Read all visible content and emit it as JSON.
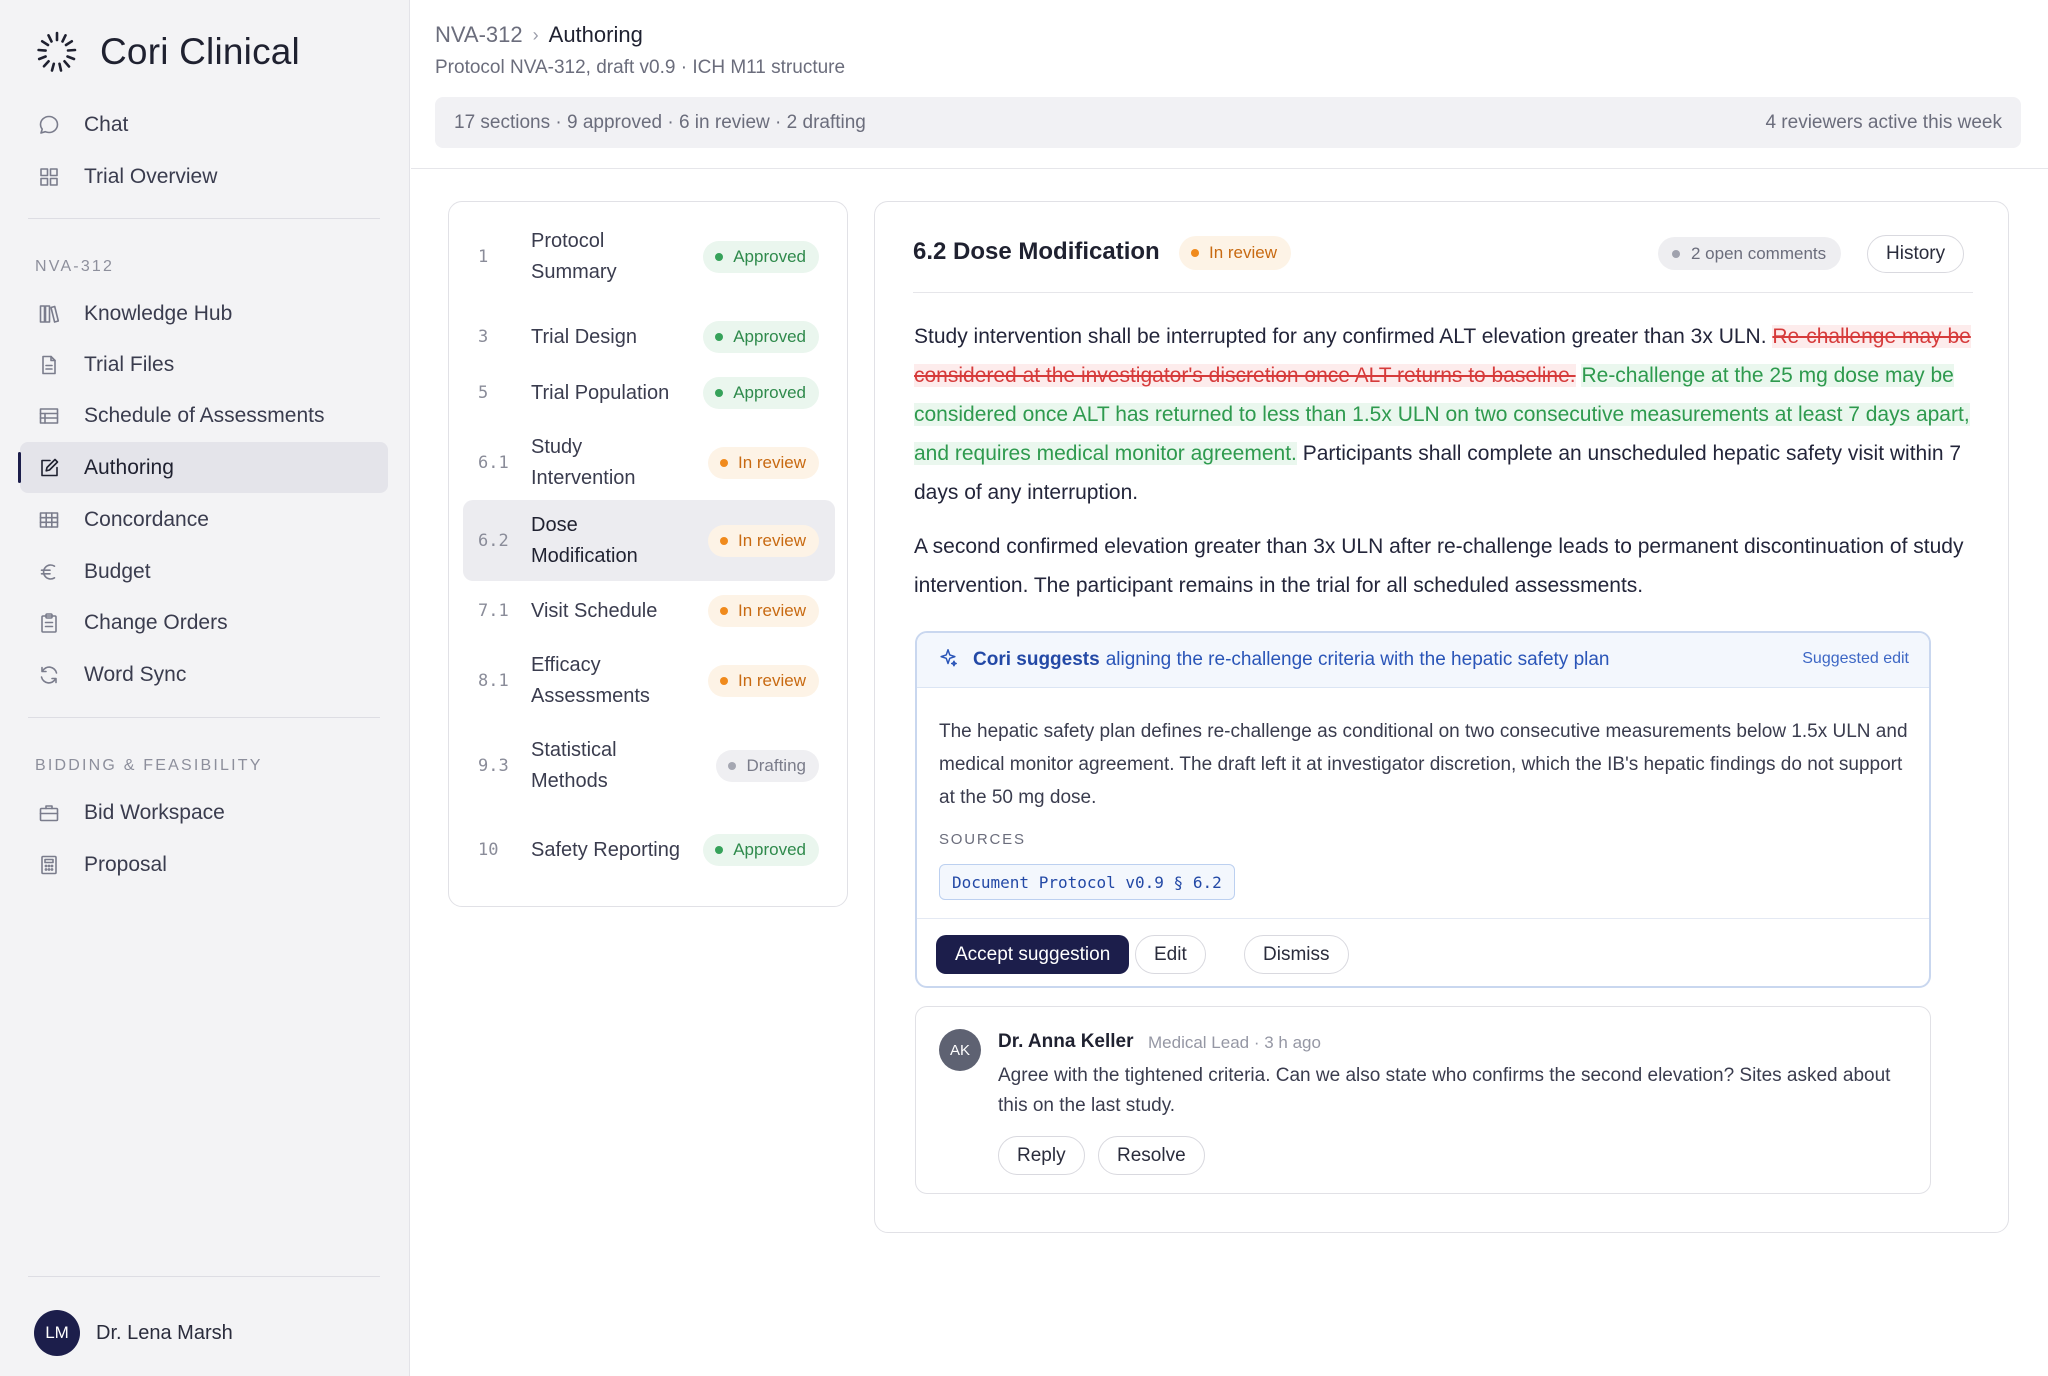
{
  "brand": {
    "name": "Cori Clinical"
  },
  "sidebar": {
    "top_items": [
      {
        "label": "Chat",
        "icon": "chat-bubble-icon"
      },
      {
        "label": "Trial Overview",
        "icon": "grid-icon"
      }
    ],
    "section_trial": "NVA-312",
    "trial_items": [
      {
        "label": "Knowledge Hub",
        "icon": "books-icon"
      },
      {
        "label": "Trial Files",
        "icon": "file-icon"
      },
      {
        "label": "Schedule of Assessments",
        "icon": "table-rows-icon"
      },
      {
        "label": "Authoring",
        "icon": "edit-icon",
        "active": true
      },
      {
        "label": "Concordance",
        "icon": "spreadsheet-icon"
      },
      {
        "label": "Budget",
        "icon": "euro-icon"
      },
      {
        "label": "Change Orders",
        "icon": "clipboard-icon"
      },
      {
        "label": "Word Sync",
        "icon": "sync-icon"
      }
    ],
    "section_bidding": "BIDDING & FEASIBILITY",
    "bidding_items": [
      {
        "label": "Bid Workspace",
        "icon": "briefcase-icon"
      },
      {
        "label": "Proposal",
        "icon": "calculator-icon"
      }
    ],
    "user": {
      "initials": "LM",
      "name": "Dr. Lena Marsh"
    }
  },
  "header": {
    "breadcrumb": [
      "NVA-312",
      "Authoring"
    ],
    "subtitle": "Protocol NVA-312, draft v0.9 · ICH M11 structure",
    "stats": "17 sections · 9 approved · 6 in review · 2 drafting",
    "reviewers": "4 reviewers active this week"
  },
  "sections": [
    {
      "num": "1",
      "title": "Protocol Summary",
      "status": "Approved",
      "kind": "approved"
    },
    {
      "num": "3",
      "title": "Trial Design",
      "status": "Approved",
      "kind": "approved"
    },
    {
      "num": "5",
      "title": "Trial Population",
      "status": "Approved",
      "kind": "approved"
    },
    {
      "num": "6.1",
      "title": "Study Intervention",
      "status": "In review",
      "kind": "review"
    },
    {
      "num": "6.2",
      "title": "Dose Modification",
      "status": "In review",
      "kind": "review",
      "active": true
    },
    {
      "num": "7.1",
      "title": "Visit Schedule",
      "status": "In review",
      "kind": "review"
    },
    {
      "num": "8.1",
      "title": "Efficacy Assessments",
      "status": "In review",
      "kind": "review"
    },
    {
      "num": "9.3",
      "title": "Statistical Methods",
      "status": "Drafting",
      "kind": "drafting"
    },
    {
      "num": "10",
      "title": "Safety Reporting",
      "status": "Approved",
      "kind": "approved"
    }
  ],
  "editor": {
    "title": "6.2 Dose Modification",
    "status": "In review",
    "open_comments": "2 open comments",
    "history_label": "History",
    "para1_start": "Study intervention shall be interrupted for any confirmed ALT elevation greater than 3x ULN. ",
    "para1_deleted": "Re-challenge may be considered at the investigator's discretion once ALT returns to baseline.",
    "para1_inserted": "Re-challenge at the 25 mg dose may be considered once ALT has returned to less than 1.5x ULN on two consecutive measurements at least 7 days apart, and requires medical monitor agreement.",
    "para1_end": " Participants shall complete an unscheduled hepatic safety visit within 7 days of any interruption.",
    "para2": "A second confirmed elevation greater than 3x ULN after re-challenge leads to permanent discontinuation of study intervention. The participant remains in the trial for all scheduled assessments."
  },
  "suggestion": {
    "who": "Cori suggests",
    "what": "aligning the re-challenge criteria with the hepatic safety plan",
    "tag": "Suggested edit",
    "body": "The hepatic safety plan defines re-challenge as conditional on two consecutive measurements below 1.5x ULN and medical monitor agreement. The draft left it at investigator discretion, which the IB's hepatic findings do not support at the 50 mg dose.",
    "sources_label": "SOURCES",
    "source_chip": "Document Protocol v0.9 § 6.2",
    "accept_label": "Accept suggestion",
    "edit_label": "Edit",
    "dismiss_label": "Dismiss"
  },
  "comment": {
    "initials": "AK",
    "author": "Dr. Anna Keller",
    "meta": "Medical Lead · 3 h ago",
    "text": "Agree with the tightened criteria. Can we also state who confirms the second elevation? Sites asked about this on the last study.",
    "reply_label": "Reply",
    "resolve_label": "Resolve"
  }
}
